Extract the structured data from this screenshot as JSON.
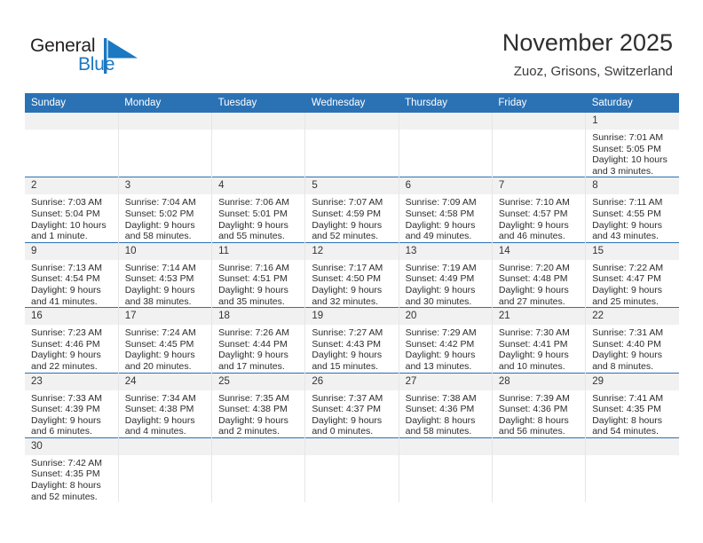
{
  "brand": {
    "name_part1": "General",
    "name_part2": "Blue",
    "flag_color": "#1b78c2"
  },
  "header": {
    "title": "November 2025",
    "subtitle": "Zuoz, Grisons, Switzerland"
  },
  "colors": {
    "header_blue": "#2b72b5",
    "daynum_gray": "#f1f1f1",
    "text": "#2c2c2c"
  },
  "weekdays": [
    "Sunday",
    "Monday",
    "Tuesday",
    "Wednesday",
    "Thursday",
    "Friday",
    "Saturday"
  ],
  "weeks": [
    [
      {
        "day": "",
        "blank": true
      },
      {
        "day": "",
        "blank": true
      },
      {
        "day": "",
        "blank": true
      },
      {
        "day": "",
        "blank": true
      },
      {
        "day": "",
        "blank": true
      },
      {
        "day": "",
        "blank": true
      },
      {
        "day": "1",
        "sunrise": "Sunrise: 7:01 AM",
        "sunset": "Sunset: 5:05 PM",
        "daylight1": "Daylight: 10 hours",
        "daylight2": "and 3 minutes."
      }
    ],
    [
      {
        "day": "2",
        "sunrise": "Sunrise: 7:03 AM",
        "sunset": "Sunset: 5:04 PM",
        "daylight1": "Daylight: 10 hours",
        "daylight2": "and 1 minute."
      },
      {
        "day": "3",
        "sunrise": "Sunrise: 7:04 AM",
        "sunset": "Sunset: 5:02 PM",
        "daylight1": "Daylight: 9 hours",
        "daylight2": "and 58 minutes."
      },
      {
        "day": "4",
        "sunrise": "Sunrise: 7:06 AM",
        "sunset": "Sunset: 5:01 PM",
        "daylight1": "Daylight: 9 hours",
        "daylight2": "and 55 minutes."
      },
      {
        "day": "5",
        "sunrise": "Sunrise: 7:07 AM",
        "sunset": "Sunset: 4:59 PM",
        "daylight1": "Daylight: 9 hours",
        "daylight2": "and 52 minutes."
      },
      {
        "day": "6",
        "sunrise": "Sunrise: 7:09 AM",
        "sunset": "Sunset: 4:58 PM",
        "daylight1": "Daylight: 9 hours",
        "daylight2": "and 49 minutes."
      },
      {
        "day": "7",
        "sunrise": "Sunrise: 7:10 AM",
        "sunset": "Sunset: 4:57 PM",
        "daylight1": "Daylight: 9 hours",
        "daylight2": "and 46 minutes."
      },
      {
        "day": "8",
        "sunrise": "Sunrise: 7:11 AM",
        "sunset": "Sunset: 4:55 PM",
        "daylight1": "Daylight: 9 hours",
        "daylight2": "and 43 minutes."
      }
    ],
    [
      {
        "day": "9",
        "sunrise": "Sunrise: 7:13 AM",
        "sunset": "Sunset: 4:54 PM",
        "daylight1": "Daylight: 9 hours",
        "daylight2": "and 41 minutes."
      },
      {
        "day": "10",
        "sunrise": "Sunrise: 7:14 AM",
        "sunset": "Sunset: 4:53 PM",
        "daylight1": "Daylight: 9 hours",
        "daylight2": "and 38 minutes."
      },
      {
        "day": "11",
        "sunrise": "Sunrise: 7:16 AM",
        "sunset": "Sunset: 4:51 PM",
        "daylight1": "Daylight: 9 hours",
        "daylight2": "and 35 minutes."
      },
      {
        "day": "12",
        "sunrise": "Sunrise: 7:17 AM",
        "sunset": "Sunset: 4:50 PM",
        "daylight1": "Daylight: 9 hours",
        "daylight2": "and 32 minutes."
      },
      {
        "day": "13",
        "sunrise": "Sunrise: 7:19 AM",
        "sunset": "Sunset: 4:49 PM",
        "daylight1": "Daylight: 9 hours",
        "daylight2": "and 30 minutes."
      },
      {
        "day": "14",
        "sunrise": "Sunrise: 7:20 AM",
        "sunset": "Sunset: 4:48 PM",
        "daylight1": "Daylight: 9 hours",
        "daylight2": "and 27 minutes."
      },
      {
        "day": "15",
        "sunrise": "Sunrise: 7:22 AM",
        "sunset": "Sunset: 4:47 PM",
        "daylight1": "Daylight: 9 hours",
        "daylight2": "and 25 minutes."
      }
    ],
    [
      {
        "day": "16",
        "sunrise": "Sunrise: 7:23 AM",
        "sunset": "Sunset: 4:46 PM",
        "daylight1": "Daylight: 9 hours",
        "daylight2": "and 22 minutes."
      },
      {
        "day": "17",
        "sunrise": "Sunrise: 7:24 AM",
        "sunset": "Sunset: 4:45 PM",
        "daylight1": "Daylight: 9 hours",
        "daylight2": "and 20 minutes."
      },
      {
        "day": "18",
        "sunrise": "Sunrise: 7:26 AM",
        "sunset": "Sunset: 4:44 PM",
        "daylight1": "Daylight: 9 hours",
        "daylight2": "and 17 minutes."
      },
      {
        "day": "19",
        "sunrise": "Sunrise: 7:27 AM",
        "sunset": "Sunset: 4:43 PM",
        "daylight1": "Daylight: 9 hours",
        "daylight2": "and 15 minutes."
      },
      {
        "day": "20",
        "sunrise": "Sunrise: 7:29 AM",
        "sunset": "Sunset: 4:42 PM",
        "daylight1": "Daylight: 9 hours",
        "daylight2": "and 13 minutes."
      },
      {
        "day": "21",
        "sunrise": "Sunrise: 7:30 AM",
        "sunset": "Sunset: 4:41 PM",
        "daylight1": "Daylight: 9 hours",
        "daylight2": "and 10 minutes."
      },
      {
        "day": "22",
        "sunrise": "Sunrise: 7:31 AM",
        "sunset": "Sunset: 4:40 PM",
        "daylight1": "Daylight: 9 hours",
        "daylight2": "and 8 minutes."
      }
    ],
    [
      {
        "day": "23",
        "sunrise": "Sunrise: 7:33 AM",
        "sunset": "Sunset: 4:39 PM",
        "daylight1": "Daylight: 9 hours",
        "daylight2": "and 6 minutes."
      },
      {
        "day": "24",
        "sunrise": "Sunrise: 7:34 AM",
        "sunset": "Sunset: 4:38 PM",
        "daylight1": "Daylight: 9 hours",
        "daylight2": "and 4 minutes."
      },
      {
        "day": "25",
        "sunrise": "Sunrise: 7:35 AM",
        "sunset": "Sunset: 4:38 PM",
        "daylight1": "Daylight: 9 hours",
        "daylight2": "and 2 minutes."
      },
      {
        "day": "26",
        "sunrise": "Sunrise: 7:37 AM",
        "sunset": "Sunset: 4:37 PM",
        "daylight1": "Daylight: 9 hours",
        "daylight2": "and 0 minutes."
      },
      {
        "day": "27",
        "sunrise": "Sunrise: 7:38 AM",
        "sunset": "Sunset: 4:36 PM",
        "daylight1": "Daylight: 8 hours",
        "daylight2": "and 58 minutes."
      },
      {
        "day": "28",
        "sunrise": "Sunrise: 7:39 AM",
        "sunset": "Sunset: 4:36 PM",
        "daylight1": "Daylight: 8 hours",
        "daylight2": "and 56 minutes."
      },
      {
        "day": "29",
        "sunrise": "Sunrise: 7:41 AM",
        "sunset": "Sunset: 4:35 PM",
        "daylight1": "Daylight: 8 hours",
        "daylight2": "and 54 minutes."
      }
    ],
    [
      {
        "day": "30",
        "sunrise": "Sunrise: 7:42 AM",
        "sunset": "Sunset: 4:35 PM",
        "daylight1": "Daylight: 8 hours",
        "daylight2": "and 52 minutes."
      },
      {
        "day": "",
        "blank": true
      },
      {
        "day": "",
        "blank": true
      },
      {
        "day": "",
        "blank": true
      },
      {
        "day": "",
        "blank": true
      },
      {
        "day": "",
        "blank": true
      },
      {
        "day": "",
        "blank": true
      }
    ]
  ]
}
